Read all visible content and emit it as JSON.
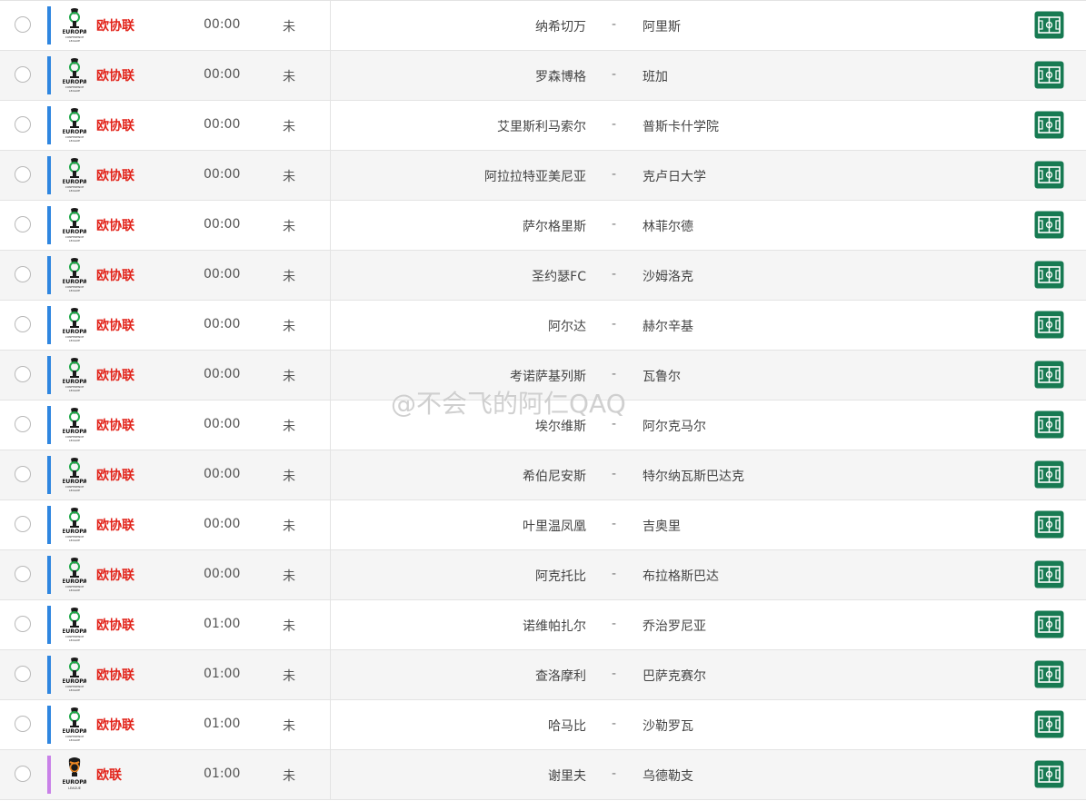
{
  "watermark": "@不会飞的阿仁QAQ",
  "colors": {
    "conference_bar": "#2f86e0",
    "europa_bar": "#c981e8",
    "league_text": "#e2231a",
    "pitch_button": "#177a52"
  },
  "icons": {
    "row_action": "football-pitch-icon",
    "league": "uefa-trophy-logo"
  },
  "matches": [
    {
      "league": "欧协联",
      "type": "conference",
      "time": "00:00",
      "status": "未",
      "home": "纳希切万",
      "dash": "-",
      "away": "阿里斯"
    },
    {
      "league": "欧协联",
      "type": "conference",
      "time": "00:00",
      "status": "未",
      "home": "罗森博格",
      "dash": "-",
      "away": "班加"
    },
    {
      "league": "欧协联",
      "type": "conference",
      "time": "00:00",
      "status": "未",
      "home": "艾里斯利马索尔",
      "dash": "-",
      "away": "普斯卡什学院"
    },
    {
      "league": "欧协联",
      "type": "conference",
      "time": "00:00",
      "status": "未",
      "home": "阿拉拉特亚美尼亚",
      "dash": "-",
      "away": "克卢日大学"
    },
    {
      "league": "欧协联",
      "type": "conference",
      "time": "00:00",
      "status": "未",
      "home": "萨尔格里斯",
      "dash": "-",
      "away": "林菲尔德"
    },
    {
      "league": "欧协联",
      "type": "conference",
      "time": "00:00",
      "status": "未",
      "home": "圣约瑟FC",
      "dash": "-",
      "away": "沙姆洛克"
    },
    {
      "league": "欧协联",
      "type": "conference",
      "time": "00:00",
      "status": "未",
      "home": "阿尔达",
      "dash": "-",
      "away": "赫尔辛基"
    },
    {
      "league": "欧协联",
      "type": "conference",
      "time": "00:00",
      "status": "未",
      "home": "考诺萨基列斯",
      "dash": "-",
      "away": "瓦鲁尔"
    },
    {
      "league": "欧协联",
      "type": "conference",
      "time": "00:00",
      "status": "未",
      "home": "埃尔维斯",
      "dash": "-",
      "away": "阿尔克马尔"
    },
    {
      "league": "欧协联",
      "type": "conference",
      "time": "00:00",
      "status": "未",
      "home": "希伯尼安斯",
      "dash": "-",
      "away": "特尔纳瓦斯巴达克"
    },
    {
      "league": "欧协联",
      "type": "conference",
      "time": "00:00",
      "status": "未",
      "home": "叶里温凤凰",
      "dash": "-",
      "away": "吉奥里"
    },
    {
      "league": "欧协联",
      "type": "conference",
      "time": "00:00",
      "status": "未",
      "home": "阿克托比",
      "dash": "-",
      "away": "布拉格斯巴达"
    },
    {
      "league": "欧协联",
      "type": "conference",
      "time": "01:00",
      "status": "未",
      "home": "诺维帕扎尔",
      "dash": "-",
      "away": "乔治罗尼亚"
    },
    {
      "league": "欧协联",
      "type": "conference",
      "time": "01:00",
      "status": "未",
      "home": "查洛摩利",
      "dash": "-",
      "away": "巴萨克赛尔"
    },
    {
      "league": "欧协联",
      "type": "conference",
      "time": "01:00",
      "status": "未",
      "home": "哈马比",
      "dash": "-",
      "away": "沙勒罗瓦"
    },
    {
      "league": "欧联",
      "type": "europa",
      "time": "01:00",
      "status": "未",
      "home": "谢里夫",
      "dash": "-",
      "away": "乌德勒支"
    }
  ]
}
